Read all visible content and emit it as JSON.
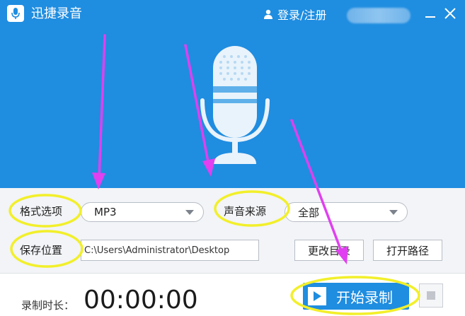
{
  "app": {
    "title": "迅捷录音",
    "login_label": "登录/注册"
  },
  "settings": {
    "format_label": "格式选项",
    "format_value": "MP3",
    "source_label": "声音来源",
    "source_value": "全部",
    "save_label": "保存位置",
    "save_path": "C:\\Users\\Administrator\\Desktop",
    "change_dir_label": "更改目录",
    "open_path_label": "打开路径"
  },
  "recording": {
    "duration_label": "录制时长：",
    "duration_value": "00:00:00",
    "start_label": "开始录制"
  },
  "colors": {
    "brand": "#1f8de0",
    "annotation_arrow": "#e040f0",
    "annotation_circle": "#f2ef2a"
  }
}
